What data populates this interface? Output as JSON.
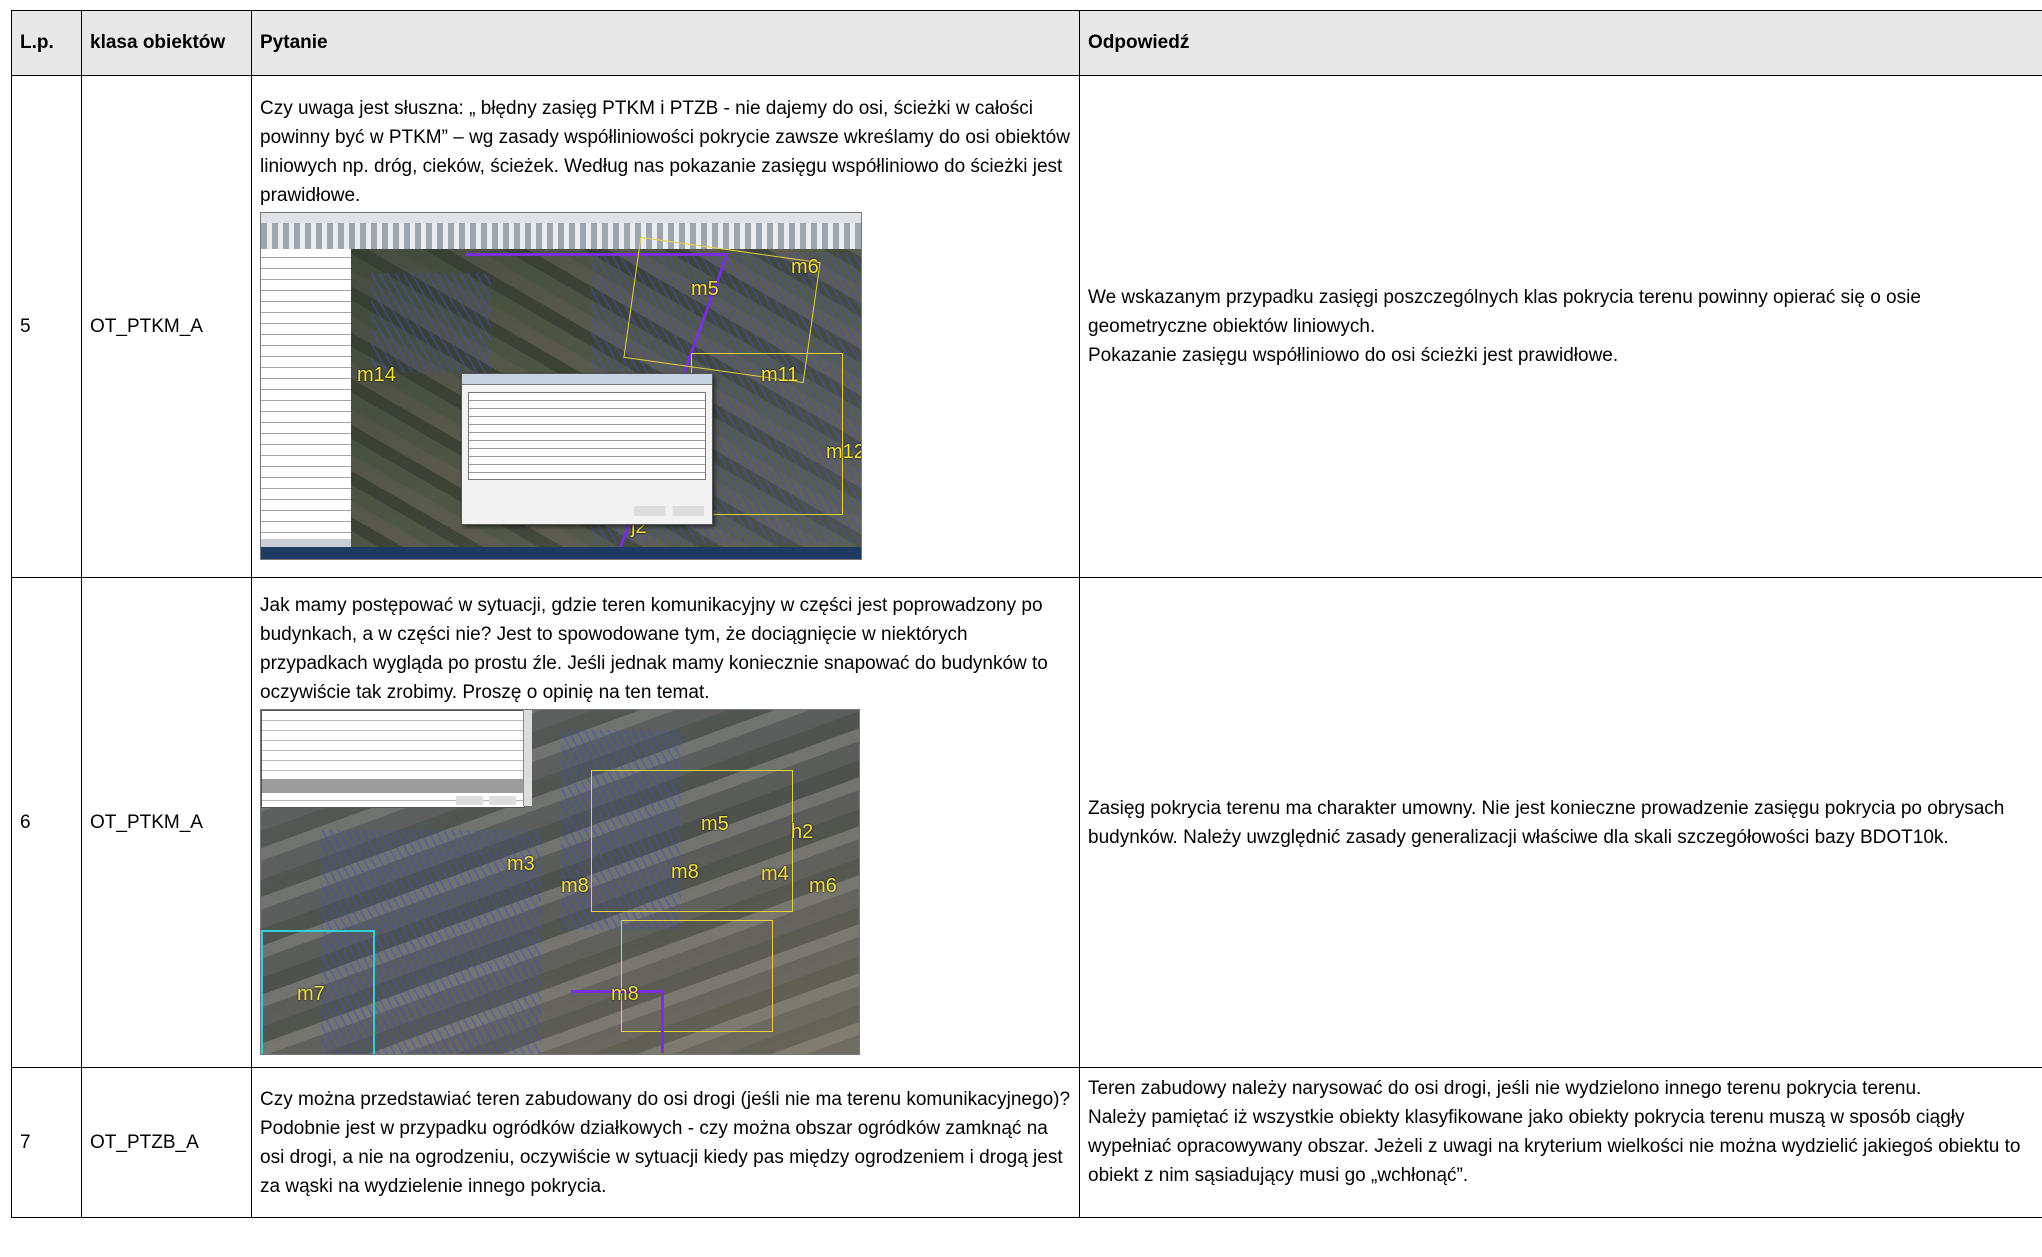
{
  "header": {
    "lp": "L.p.",
    "klasa": "klasa obiektów",
    "pytanie": "Pytanie",
    "odpowiedz": "Odpowiedź"
  },
  "rows": [
    {
      "lp": "5",
      "klasa": "OT_PTKM_A",
      "pytanie": "Czy uwaga jest słuszna: „ błędny zasięg PTKM i PTZB - nie dajemy do osi, ścieżki w całości powinny być w PTKM” – wg zasady współliniowości pokrycie zawsze wkreślamy do osi obiektów liniowych np. dróg, cieków, ścieżek. Według nas pokazanie zasięgu współliniowo do ścieżki jest prawidłowe.",
      "odpowiedz": [
        "We wskazanym przypadku zasięgi poszczególnych  klas pokrycia terenu powinny opierać się o osie geometryczne obiektów liniowych.",
        "Pokazanie zasięgu współliniowo do osi ścieżki jest prawidłowe."
      ],
      "map_labels": [
        "m6",
        "m5",
        "m14",
        "m11",
        "m12",
        "j2"
      ]
    },
    {
      "lp": "6",
      "klasa": "OT_PTKM_A",
      "pytanie": "Jak mamy postępować w sytuacji, gdzie teren komunikacyjny w części jest poprowadzony po budynkach, a w części nie? Jest to spowodowane tym, że dociągnięcie w niektórych przypadkach wygląda po prostu źle. Jeśli jednak mamy koniecznie snapować do budynków to oczywiście tak zrobimy. Proszę o opinię na ten temat.",
      "odpowiedz": [
        "Zasięg pokrycia terenu ma charakter umowny. Nie jest konieczne prowadzenie zasięgu pokrycia po obrysach budynków. Należy uwzględnić zasady generalizacji właściwe dla skali szczegółowości bazy BDOT10k."
      ],
      "map_labels": [
        "m5",
        "h2",
        "m4",
        "m8",
        "m6",
        "m3",
        "m8",
        "m7",
        "m8"
      ]
    },
    {
      "lp": "7",
      "klasa": "OT_PTZB_A",
      "pytanie": "Czy można przedstawiać teren zabudowany do osi drogi (jeśli nie ma terenu komunikacyjnego)? Podobnie jest w przypadku ogródków działkowych - czy można obszar ogródków zamknąć na osi drogi, a nie na ogrodzeniu, oczywiście w sytuacji kiedy pas między ogrodzeniem i drogą jest za wąski na wydzielenie innego pokrycia.",
      "odpowiedz": [
        "Teren zabudowy należy narysować do osi drogi, jeśli nie wydzielono innego terenu pokrycia terenu.",
        "Należy pamiętać iż wszystkie obiekty klasyfikowane jako obiekty pokrycia terenu muszą w sposób ciągły wypełniać opracowywany obszar. Jeżeli z uwagi na kryterium wielkości nie można wydzielić jakiegoś obiektu to obiekt z nim sąsiadujący musi go „wchłonąć”."
      ]
    }
  ]
}
